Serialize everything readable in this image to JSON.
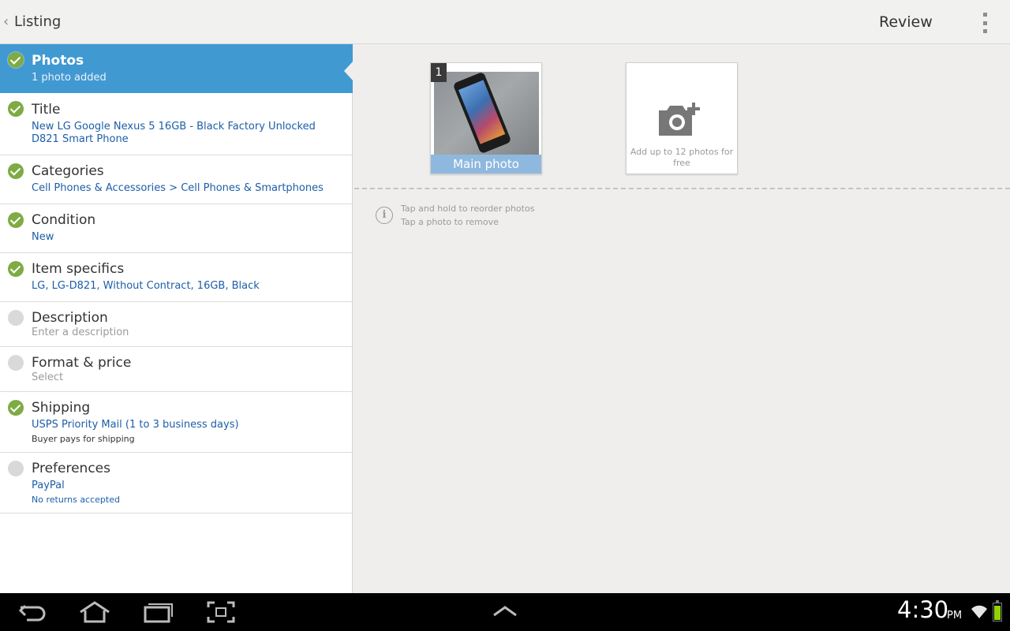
{
  "actionbar": {
    "title": "Listing",
    "review_label": "Review"
  },
  "list": [
    {
      "title": "Photos",
      "value": "1 photo added",
      "done": true,
      "selected": true
    },
    {
      "title": "Title",
      "value": "New LG Google Nexus 5 16GB - Black Factory Unlocked  D821 Smart Phone",
      "done": true
    },
    {
      "title": "Categories",
      "value": "Cell Phones & Accessories > Cell Phones & Smartphones",
      "done": true
    },
    {
      "title": "Condition",
      "value": "New",
      "done": true
    },
    {
      "title": "Item specifics",
      "value": "LG, LG-D821, Without Contract, 16GB, Black",
      "done": true
    },
    {
      "title": "Description",
      "value": "Enter a description",
      "done": false
    },
    {
      "title": "Format & price",
      "value": "Select",
      "done": false
    },
    {
      "title": "Shipping",
      "value": "USPS Priority Mail (1 to 3 business days)",
      "sub": "Buyer pays for shipping",
      "done": true
    },
    {
      "title": "Preferences",
      "value": "PayPal",
      "sub": "No returns accepted",
      "done": false
    }
  ],
  "photos": {
    "main": {
      "number": "1",
      "label": "Main photo"
    },
    "add_text": "Add up to 12 photos for free",
    "hints": [
      "Tap and hold to reorder photos",
      "Tap a photo to remove"
    ]
  },
  "status": {
    "time": "4:30",
    "ampm": "PM"
  },
  "colors": {
    "selected_row": "#4199d2",
    "check_done": "#7eab43",
    "link_value": "#1c5ea8",
    "battery": "#8fd400"
  }
}
